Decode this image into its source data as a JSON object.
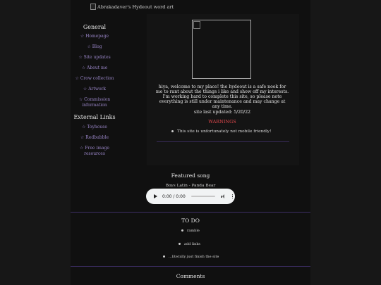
{
  "header": {
    "art_alt": "Abrakadaver's Hydeout word art"
  },
  "sidebar": {
    "general_title": "General",
    "general_links": [
      "☆ Homepage",
      "☆ Blog",
      "☆ Site updates",
      "☆ About me",
      "☆ Crow collection",
      "☆ Artwork",
      "☆ Commission information"
    ],
    "external_title": "External Links",
    "external_links": [
      "☆ Toyhouse",
      "☆ Redbubble",
      "☆ Free image resources"
    ]
  },
  "main": {
    "intro": "hiya, welcome to my place! the hydeout is a safe nook for me to rant about the things i like and show off my interests. I'm working hard to complete this site, so please note everything is still under maintenance and may change at any time.",
    "last_updated": "site last updated: 5/20/22",
    "warnings_title": "WARNINGS",
    "warnings": [
      "This site is unfortunately not mobile friendly!"
    ]
  },
  "featured": {
    "title": "Featured song",
    "song": "Boys Latin - Panda Bear",
    "time": "0:00 / 0:00"
  },
  "todo": {
    "title": "TO DO",
    "items": [
      "ramble",
      "add links",
      "...literally just finish the site"
    ]
  },
  "comments": {
    "title": "Comments"
  },
  "colors": {
    "link": "#9a86c8",
    "warning": "#e0484c",
    "divider": "#3e2f66",
    "background": "#171717"
  }
}
